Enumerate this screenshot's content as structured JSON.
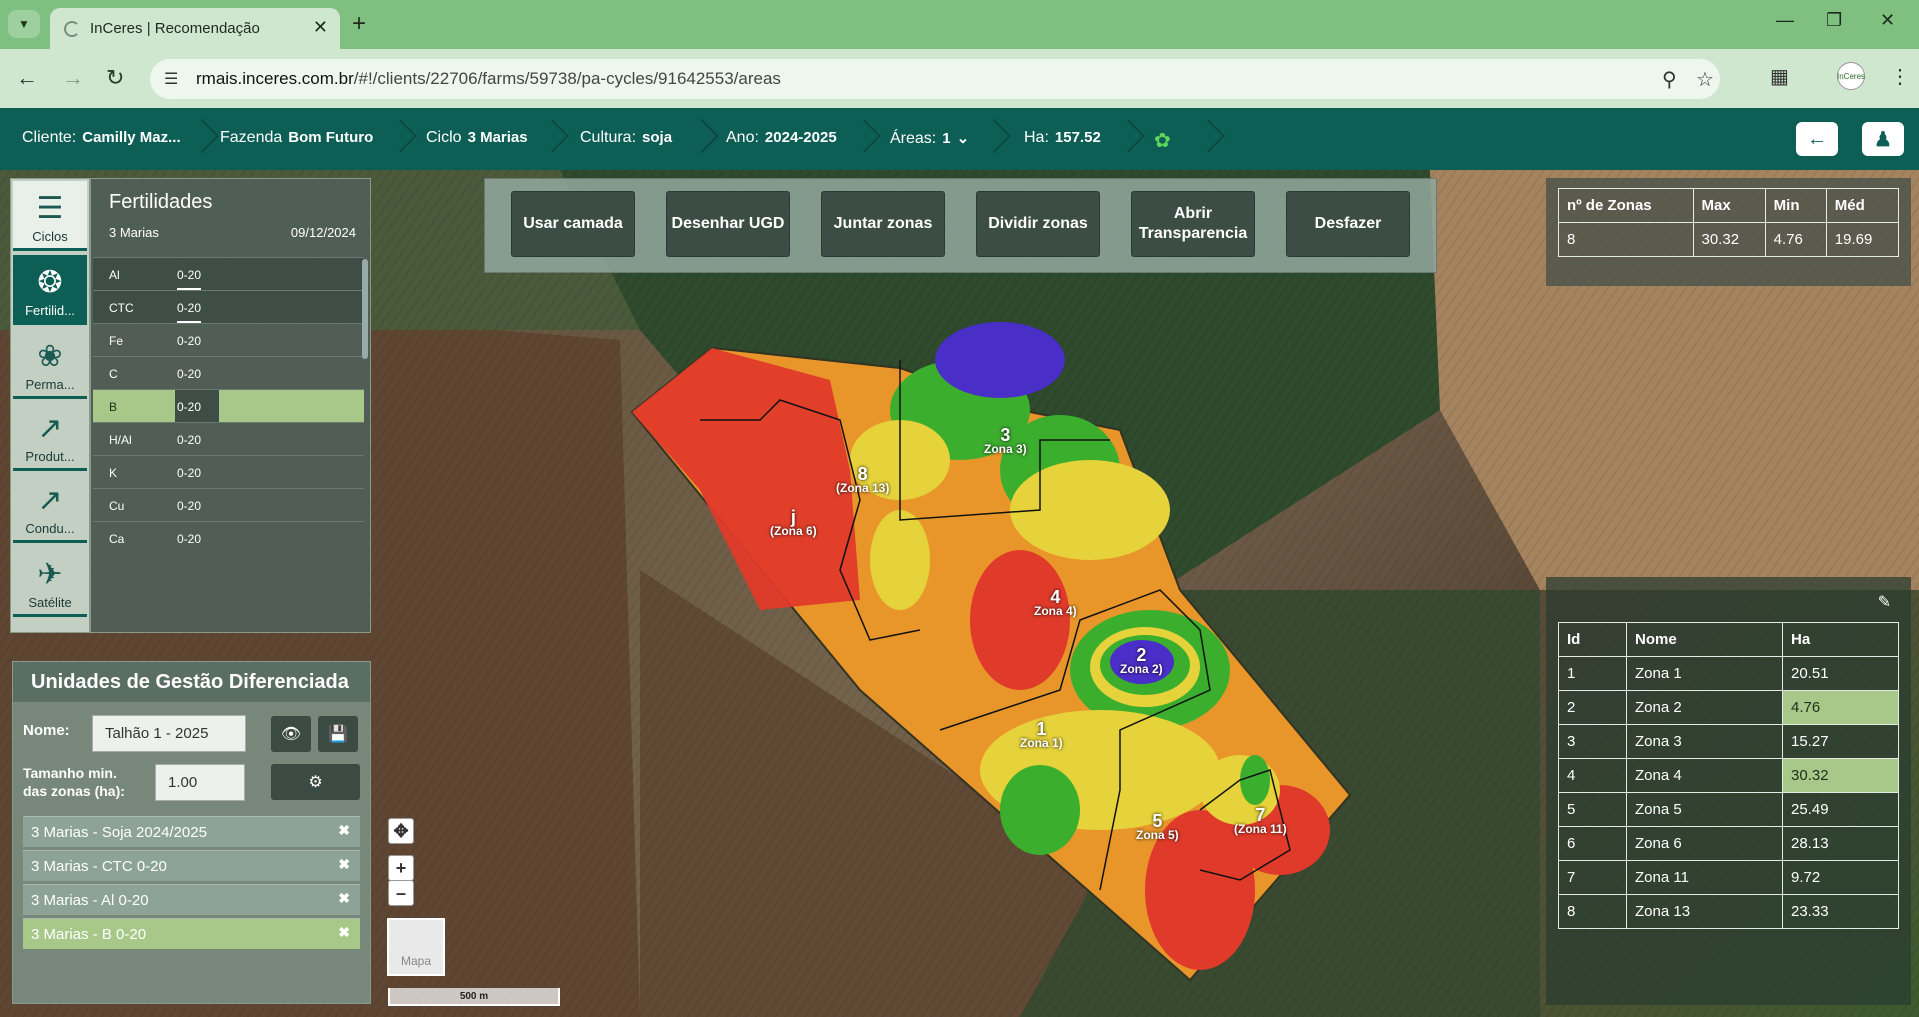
{
  "browser": {
    "tab_title": "InCeres | Recomendação",
    "url_domain": "rmais.inceres.com.br",
    "url_path": "/#!/clients/22706/farms/59738/pa-cycles/91642553/areas",
    "profile_label": "InCeres"
  },
  "header": {
    "cliente_label": "Cliente:",
    "cliente_value": "Camilly Maz...",
    "fazenda_label": "Fazenda",
    "fazenda_value": "Bom Futuro",
    "ciclo_label": "Ciclo",
    "ciclo_value": "3 Marias",
    "cultura_label": "Cultura:",
    "cultura_value": "soja",
    "ano_label": "Ano:",
    "ano_value": "2024-2025",
    "areas_label": "Áreas:",
    "areas_value": "1",
    "ha_label": "Ha:",
    "ha_value": "157.52"
  },
  "sidebar": {
    "items": [
      {
        "label": "Ciclos",
        "icon": "list-icon"
      },
      {
        "label": "Fertilid...",
        "icon": "fertility-icon"
      },
      {
        "label": "Perma...",
        "icon": "plant-icon"
      },
      {
        "label": "Produt...",
        "icon": "chart-icon"
      },
      {
        "label": "Condu...",
        "icon": "chart-icon"
      },
      {
        "label": "Satélite",
        "icon": "satellite-icon"
      }
    ]
  },
  "fertility": {
    "title": "Fertilidades",
    "subtitle": "3 Marias",
    "date": "09/12/2024",
    "rows": [
      {
        "name": "Al",
        "depth": "0-20"
      },
      {
        "name": "CTC",
        "depth": "0-20"
      },
      {
        "name": "Fe",
        "depth": "0-20"
      },
      {
        "name": "C",
        "depth": "0-20"
      },
      {
        "name": "B",
        "depth": "0-20"
      },
      {
        "name": "H/Al",
        "depth": "0-20"
      },
      {
        "name": "K",
        "depth": "0-20"
      },
      {
        "name": "Cu",
        "depth": "0-20"
      },
      {
        "name": "Ca",
        "depth": "0-20"
      }
    ]
  },
  "ugd": {
    "title": "Unidades de Gestão Diferenciada",
    "name_label": "Nome:",
    "name_value": "Talhão 1 - 2025",
    "min_size_label": "Tamanho min. das zonas (ha):",
    "min_size_value": "1.00",
    "layers": [
      "3 Marias - Soja 2024/2025",
      "3 Marias - CTC 0-20",
      "3 Marias - Al 0-20",
      "3 Marias - B 0-20"
    ]
  },
  "tools": {
    "usar_camada": "Usar camada",
    "desenhar_ugd": "Desenhar UGD",
    "juntar_zonas": "Juntar zonas",
    "dividir_zonas": "Dividir zonas",
    "abrir_transparencia": "Abrir Transparencia",
    "desfazer": "Desfazer"
  },
  "stats": {
    "headers": [
      "nº de Zonas",
      "Max",
      "Min",
      "Méd"
    ],
    "values": [
      "8",
      "30.32",
      "4.76",
      "19.69"
    ]
  },
  "zones_table": {
    "headers": [
      "Id",
      "Nome",
      "Ha"
    ],
    "rows": [
      {
        "id": "1",
        "name": "Zona 1",
        "ha": "20.51"
      },
      {
        "id": "2",
        "name": "Zona 2",
        "ha": "4.76"
      },
      {
        "id": "3",
        "name": "Zona 3",
        "ha": "15.27"
      },
      {
        "id": "4",
        "name": "Zona 4",
        "ha": "30.32"
      },
      {
        "id": "5",
        "name": "Zona 5",
        "ha": "25.49"
      },
      {
        "id": "6",
        "name": "Zona 6",
        "ha": "28.13"
      },
      {
        "id": "7",
        "name": "Zona 11",
        "ha": "9.72"
      },
      {
        "id": "8",
        "name": "Zona 13",
        "ha": "23.33"
      }
    ]
  },
  "map_labels": [
    {
      "num": "8",
      "name": "(Zona 13)"
    },
    {
      "num": "3",
      "name": "Zona 3)"
    },
    {
      "num": "j",
      "name": "(Zona 6)"
    },
    {
      "num": "4",
      "name": "Zona 4)"
    },
    {
      "num": "2",
      "name": "Zona 2)"
    },
    {
      "num": "1",
      "name": "Zona 1)"
    },
    {
      "num": "5",
      "name": "Zona 5)"
    },
    {
      "num": "7",
      "name": "(Zona 11)"
    }
  ],
  "map_controls": {
    "mapa_label": "Mapa",
    "scale_label": "500 m"
  },
  "colors": {
    "header_bg": "#0d5e55",
    "highlight": "#a8c88a",
    "zone_red": "#e03a2a",
    "zone_orange": "#e8962a",
    "zone_yellow": "#e6d23a",
    "zone_green": "#3cae2e",
    "zone_blue": "#4a2ec8"
  }
}
